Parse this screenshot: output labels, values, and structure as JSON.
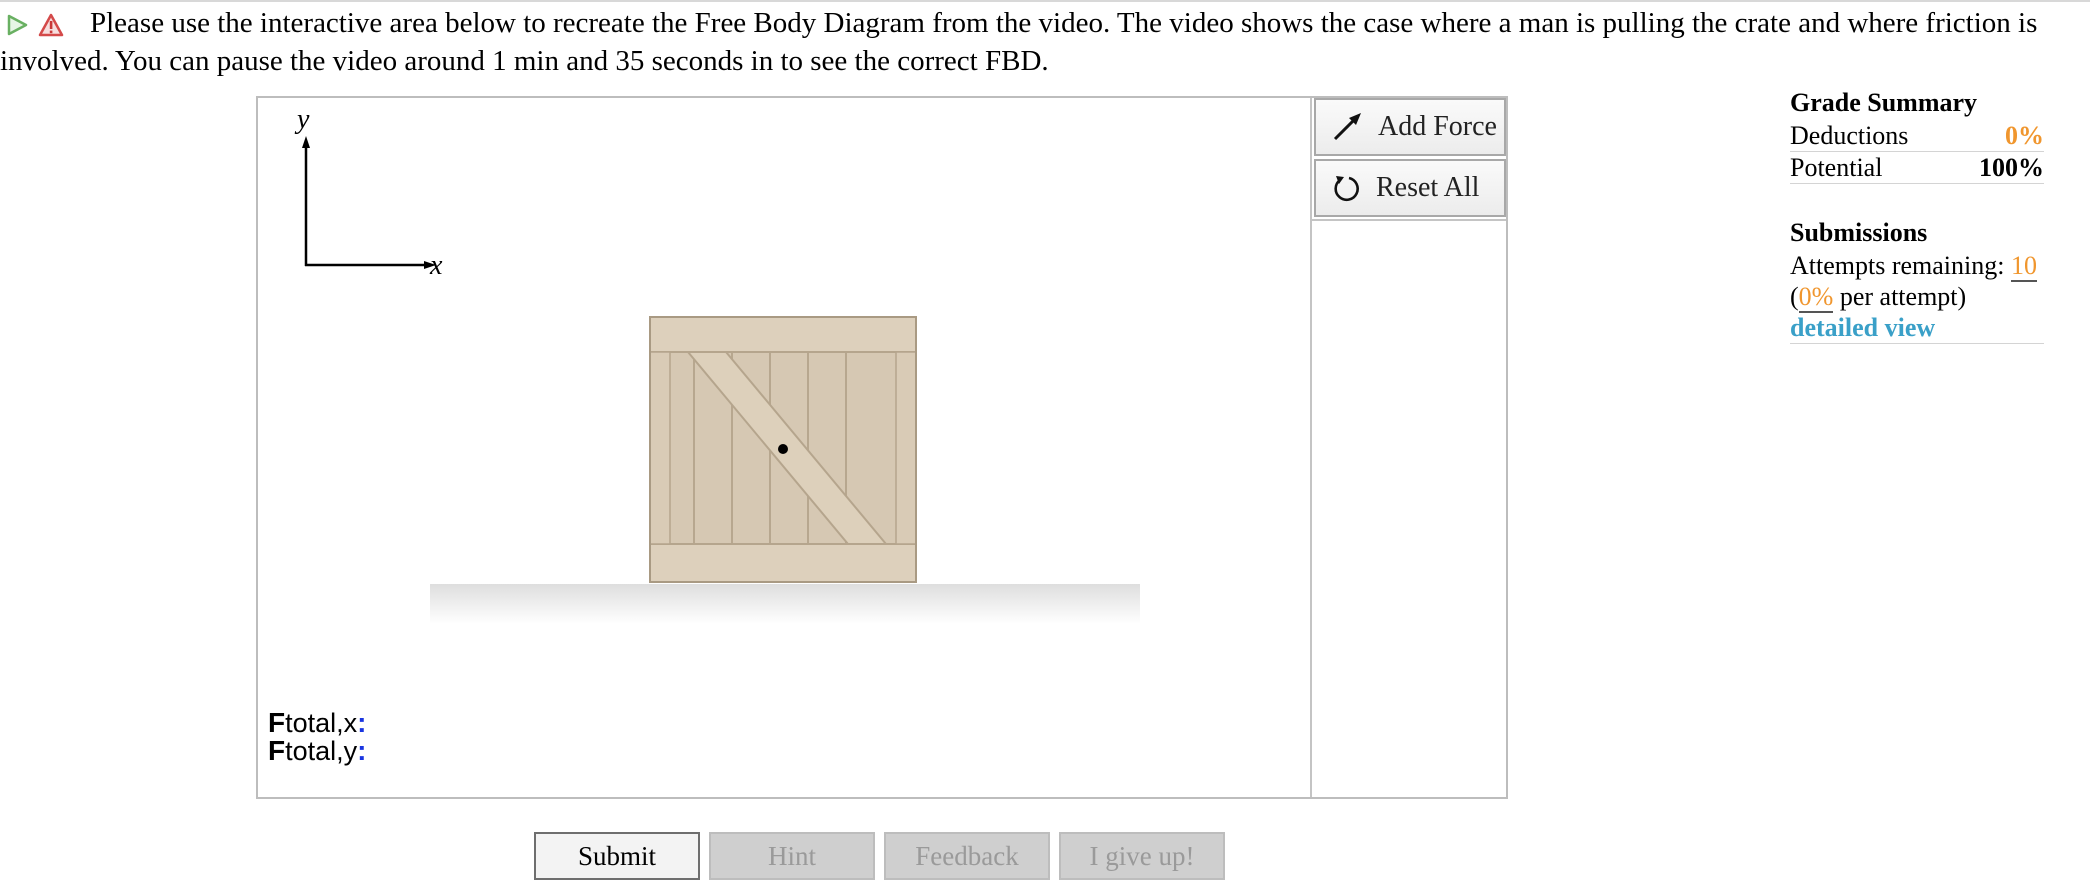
{
  "question": {
    "text": "Please use the interactive area below to recreate the Free Body Diagram from the video. The video shows the case where a man is pulling the crate and where friction is involved. You can pause the video around 1 min and 35 seconds in to see the correct FBD."
  },
  "axes": {
    "y_label": "y",
    "x_label": "x"
  },
  "toolbar": {
    "add_force": "Add Force",
    "reset_all": "Reset All"
  },
  "force_totals": {
    "symbol": "F",
    "x_sub": "total,x",
    "y_sub": "total,y",
    "colon": ":"
  },
  "actions": {
    "submit": "Submit",
    "hint": "Hint",
    "feedback": "Feedback",
    "give_up": "I give up!"
  },
  "grade_summary": {
    "title": "Grade Summary",
    "deductions_label": "Deductions",
    "deductions_value": "0%",
    "potential_label": "Potential",
    "potential_value": "100%"
  },
  "submissions": {
    "title": "Submissions",
    "attempts_label": "Attempts remaining:",
    "attempts_value": "10",
    "paren_open": "(",
    "per_attempt_value": "0%",
    "per_attempt_label": "per attempt)",
    "detailed_view": "detailed view"
  },
  "colors": {
    "accent_orange": "#f0962e",
    "link_blue": "#3aa0c8",
    "crate": "#d8cab5"
  },
  "icons": [
    "play-icon",
    "warning-icon",
    "arrow-icon",
    "reset-icon"
  ]
}
